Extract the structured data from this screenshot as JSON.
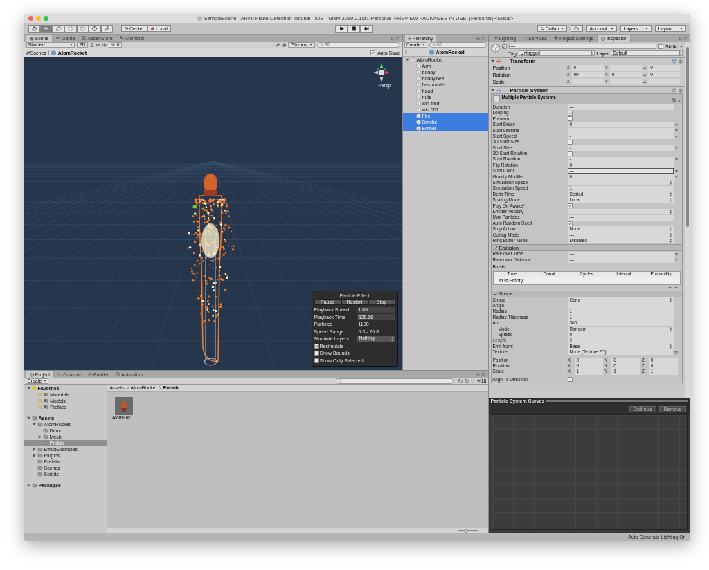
{
  "window": {
    "title": "SampleScene - ARKit Plane Detection Tutorial - iOS - Unity 2019.2.18f1 Personal [PREVIEW PACKAGES IN USE] (Personal) <Metal>"
  },
  "toolbar": {
    "tools": [
      {
        "kind": "hand",
        "selected": false
      },
      {
        "kind": "move",
        "selected": true
      },
      {
        "kind": "rotate",
        "selected": false
      },
      {
        "kind": "scale",
        "selected": false
      },
      {
        "kind": "rect",
        "selected": false
      },
      {
        "kind": "transform",
        "selected": false
      },
      {
        "kind": "custom",
        "selected": false
      }
    ],
    "pivot": [
      "Center",
      "Local"
    ],
    "collab": "Collab",
    "account": "Account",
    "layers": "Layers",
    "layout": "Layout"
  },
  "scene": {
    "tabs": [
      {
        "label": "Scene",
        "kind": "scene",
        "selected": true
      },
      {
        "label": "Game",
        "kind": "game",
        "selected": false
      },
      {
        "label": "Asset Store",
        "kind": "store",
        "selected": false
      },
      {
        "label": "Animator",
        "kind": "animator",
        "selected": false
      }
    ],
    "shading": "Shaded",
    "mode_2d": "2D",
    "hidden_count": "0",
    "gizmos": "Gizmos",
    "search_placeholder": "All",
    "breadcrumb": [
      "Scenes",
      "AtomRocket"
    ],
    "auto_save": {
      "label": "Auto Save",
      "checked": true
    },
    "projection": "Persp",
    "particle_effect": {
      "title": "Particle Effect",
      "buttons": [
        "Pause",
        "Restart",
        "Stop"
      ],
      "rows": [
        {
          "kind": "field",
          "label": "Playback Speed",
          "value": "1.00"
        },
        {
          "kind": "field",
          "label": "Playback Time",
          "value": "526.16"
        },
        {
          "kind": "text",
          "label": "Particles",
          "value": "1100"
        },
        {
          "kind": "text",
          "label": "Speed Range",
          "value": "0.3 - 26.8"
        },
        {
          "kind": "dropdown",
          "label": "Simulate Layers",
          "value": "Nothing"
        }
      ],
      "checks": [
        {
          "label": "Resimulate",
          "checked": true
        },
        {
          "label": "Show Bounds",
          "checked": false
        },
        {
          "label": "Show Only Selected",
          "checked": false
        }
      ]
    }
  },
  "hierarchy": {
    "tab": "Hierarchy",
    "create": "Create",
    "search_placeholder": "All",
    "scene": "AtomRocket",
    "tree": [
      {
        "label": "AtomRocket",
        "expanded": true,
        "selected": false,
        "children": [
          {
            "label": "Arm",
            "selected": false
          },
          {
            "label": "boddy",
            "selected": false
          },
          {
            "label": "boddy.belt",
            "selected": false
          },
          {
            "label": "fire-nozzle",
            "selected": false
          },
          {
            "label": "head",
            "selected": false
          },
          {
            "label": "nute",
            "selected": false
          },
          {
            "label": "win-frem",
            "selected": false
          },
          {
            "label": "win.001",
            "selected": false
          },
          {
            "label": "Fire",
            "selected": true
          },
          {
            "label": "Smoke",
            "selected": true
          },
          {
            "label": "Ember",
            "selected": true
          }
        ]
      }
    ]
  },
  "inspector": {
    "tabs": [
      {
        "label": "Lighting",
        "kind": "lighting",
        "selected": false
      },
      {
        "label": "Services",
        "kind": "services",
        "selected": false
      },
      {
        "label": "Project Settings",
        "kind": "settings",
        "selected": false
      },
      {
        "label": "Inspector",
        "kind": "info",
        "selected": true
      }
    ],
    "header": {
      "active": true,
      "name": "—",
      "static": {
        "label": "Static",
        "checked": false
      },
      "tag_label": "Tag",
      "tag": "Untagged",
      "layer_label": "Layer",
      "layer": "Default"
    },
    "transform": {
      "title": "Transform",
      "expanded": true,
      "rows": [
        {
          "label": "Position",
          "values": [
            {
              "axis": "X",
              "value": "0"
            },
            {
              "axis": "Y",
              "value": "—"
            },
            {
              "axis": "Z",
              "value": "0"
            }
          ]
        },
        {
          "label": "Rotation",
          "values": [
            {
              "axis": "X",
              "value": "90"
            },
            {
              "axis": "Y",
              "value": "0"
            },
            {
              "axis": "Z",
              "value": "0"
            }
          ]
        },
        {
          "label": "Scale",
          "values": [
            {
              "axis": "X",
              "value": "—"
            },
            {
              "axis": "Y",
              "value": "—"
            },
            {
              "axis": "Z",
              "value": "—"
            }
          ]
        }
      ]
    },
    "particle_system": {
      "title": "Particle System",
      "expanded": true,
      "header": "Multiple Particle Systems",
      "rows": [
        {
          "kind": "field",
          "label": "Duration",
          "value": "—"
        },
        {
          "kind": "check",
          "label": "Looping",
          "checked": true
        },
        {
          "kind": "check",
          "label": "Prewarm",
          "checked": false
        },
        {
          "kind": "curve",
          "label": "Start Delay",
          "value": "0"
        },
        {
          "kind": "curve",
          "label": "Start Lifetime",
          "value": "—"
        },
        {
          "kind": "curve",
          "label": "Start Speed",
          "value": "-"
        },
        {
          "kind": "check",
          "label": "3D Start Size",
          "checked": false
        },
        {
          "kind": "curve",
          "label": "Start Size",
          "value": "-"
        },
        {
          "kind": "check",
          "label": "3D Start Rotation",
          "checked": false
        },
        {
          "kind": "curve",
          "label": "Start Rotation",
          "value": "-"
        },
        {
          "kind": "field",
          "label": "Flip Rotation",
          "value": "0"
        },
        {
          "kind": "color",
          "label": "Start Color",
          "value": "—"
        },
        {
          "kind": "curve",
          "label": "Gravity Modifier",
          "value": "0"
        },
        {
          "kind": "dropdown",
          "label": "Simulation Space",
          "value": "—"
        },
        {
          "kind": "field",
          "label": "Simulation Speed",
          "value": "1"
        },
        {
          "kind": "dropdown",
          "label": "Delta Time",
          "value": "Scaled"
        },
        {
          "kind": "dropdown",
          "label": "Scaling Mode",
          "value": "Local"
        },
        {
          "kind": "check",
          "label": "Play On Awake*",
          "checked": true
        },
        {
          "kind": "dropdown",
          "label": "Emitter Velocity",
          "value": "—"
        },
        {
          "kind": "field",
          "label": "Max Particles",
          "value": "—"
        },
        {
          "kind": "check",
          "label": "Auto Random Seed",
          "checked": true
        },
        {
          "kind": "dropdown",
          "label": "Stop Action",
          "value": "None"
        },
        {
          "kind": "dropdown",
          "label": "Culling Mode",
          "value": "—"
        },
        {
          "kind": "dropdown",
          "label": "Ring Buffer Mode",
          "value": "Disabled"
        }
      ],
      "modules": [
        {
          "title": "Emission",
          "enabled": true,
          "rows": [
            {
              "kind": "curve",
              "label": "Rate over Time",
              "value": "—",
              "disabled": false
            },
            {
              "kind": "curve",
              "label": "Rate over Distance",
              "value": "—",
              "disabled": false
            }
          ],
          "bursts": {
            "label": "Bursts",
            "columns": [
              "Time",
              "Count",
              "Cycles",
              "Interval",
              "Probability"
            ],
            "empty": "List is Empty"
          }
        },
        {
          "title": "Shape",
          "enabled": true,
          "rows": [
            {
              "kind": "dropdown",
              "label": "Shape",
              "value": "Cone",
              "disabled": false
            },
            {
              "kind": "field",
              "label": "Angle",
              "value": "—",
              "disabled": false
            },
            {
              "kind": "field",
              "label": "Radius",
              "value": "1",
              "disabled": false
            },
            {
              "kind": "field",
              "label": "Radius Thickness",
              "value": "1",
              "disabled": false
            },
            {
              "kind": "field",
              "label": "Arc",
              "value": "360",
              "disabled": false,
              "children": [
                {
                  "kind": "dropdown",
                  "label": "Mode",
                  "value": "Random",
                  "disabled": false
                },
                {
                  "kind": "field",
                  "label": "Spread",
                  "value": "0",
                  "disabled": false
                }
              ]
            },
            {
              "kind": "field",
              "label": "Length",
              "value": "5",
              "disabled": true
            },
            {
              "kind": "dropdown",
              "label": "Emit from:",
              "value": "Base",
              "disabled": false
            },
            {
              "kind": "object",
              "label": "Texture",
              "value": "None (Texture 2D)",
              "disabled": false
            },
            {
              "kind": "xyz",
              "label": "Position",
              "disabled": false,
              "values": [
                {
                  "axis": "X",
                  "value": "0"
                },
                {
                  "axis": "Y",
                  "value": "0"
                },
                {
                  "axis": "Z",
                  "value": "0"
                }
              ]
            },
            {
              "kind": "xyz",
              "label": "Rotation",
              "disabled": false,
              "values": [
                {
                  "axis": "X",
                  "value": "0"
                },
                {
                  "axis": "Y",
                  "value": "0"
                },
                {
                  "axis": "Z",
                  "value": "0"
                }
              ]
            },
            {
              "kind": "xyz",
              "label": "Scale",
              "disabled": false,
              "values": [
                {
                  "axis": "X",
                  "value": "1"
                },
                {
                  "axis": "Y",
                  "value": "1"
                },
                {
                  "axis": "Z",
                  "value": "1"
                }
              ]
            },
            {
              "kind": "check",
              "label": "Align To Direction",
              "checked": false,
              "disabled": false
            }
          ]
        }
      ]
    }
  },
  "curves": {
    "title": "Particle System Curves",
    "buttons": [
      {
        "label": "Optimize",
        "disabled": true
      },
      {
        "label": "Remove",
        "disabled": true
      }
    ]
  },
  "project": {
    "tabs": [
      {
        "label": "Project",
        "kind": "project",
        "selected": true
      },
      {
        "label": "Console",
        "kind": "console",
        "selected": false
      },
      {
        "label": "Profiler",
        "kind": "profiler",
        "selected": false
      },
      {
        "label": "Animation",
        "kind": "animation",
        "selected": false
      }
    ],
    "create": "Create",
    "hidden_count": "18",
    "tree": [
      {
        "label": "Favorites",
        "kind": "star",
        "expanded": true,
        "selected": false,
        "children": [
          {
            "label": "All Materials",
            "kind": "search",
            "selected": false
          },
          {
            "label": "All Models",
            "kind": "search",
            "selected": false
          },
          {
            "label": "All Prefabs",
            "kind": "search",
            "selected": false
          }
        ]
      },
      {
        "label": "Assets",
        "kind": "folder",
        "expanded": true,
        "selected": false,
        "children": [
          {
            "label": "AtomRocket",
            "kind": "folder",
            "expanded": true,
            "selected": false,
            "children": [
              {
                "label": "Demo",
                "kind": "folder",
                "selected": false
              },
              {
                "label": "Mesh",
                "kind": "folder",
                "expanded": false,
                "selected": false
              },
              {
                "label": "Prefab",
                "kind": "folder",
                "selected": true
              }
            ]
          },
          {
            "label": "EffectExamples",
            "kind": "folder",
            "expanded": false,
            "selected": false
          },
          {
            "label": "Plugins",
            "kind": "folder",
            "expanded": false,
            "selected": false
          },
          {
            "label": "Prefabs",
            "kind": "folder",
            "selected": false
          },
          {
            "label": "Scenes",
            "kind": "folder",
            "selected": false
          },
          {
            "label": "Scripts",
            "kind": "folder",
            "selected": false
          }
        ]
      },
      {
        "label": "Packages",
        "kind": "folder",
        "expanded": false,
        "selected": false
      }
    ],
    "breadcrumb": [
      "Assets",
      "AtomRocket",
      "Prefab"
    ],
    "assets": [
      {
        "label": "AtomRoc…"
      }
    ],
    "zoom_slider": {
      "level": 0.4
    }
  },
  "status_bar": {
    "text": "Auto Generate Lighting On"
  }
}
